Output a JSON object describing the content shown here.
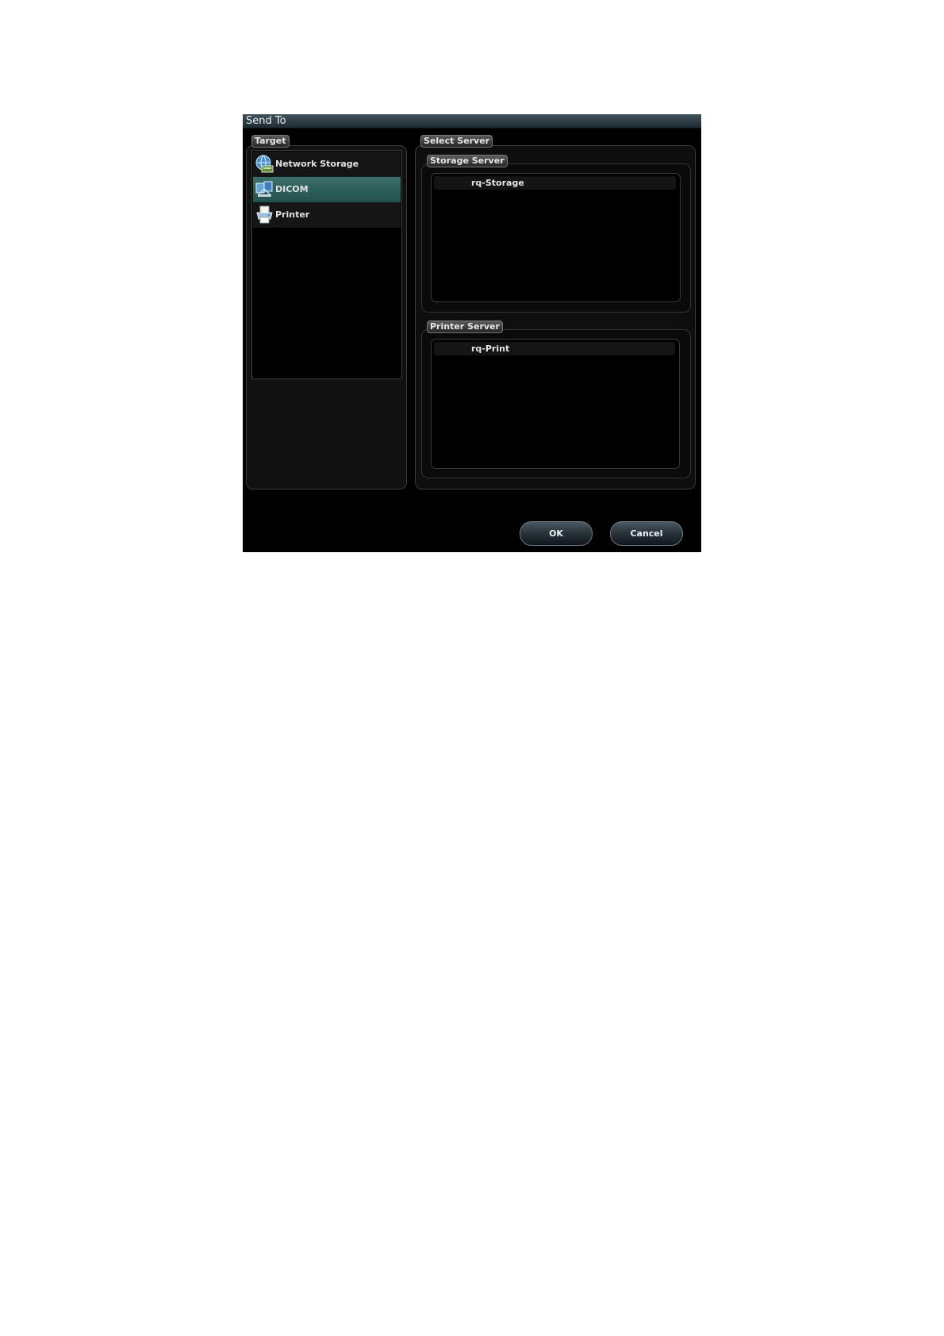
{
  "dialog": {
    "title": "Send To"
  },
  "target": {
    "label": "Target",
    "items": [
      {
        "label": "Network Storage",
        "icon": "network-storage-icon",
        "selected": false
      },
      {
        "label": "DICOM",
        "icon": "dicom-icon",
        "selected": true
      },
      {
        "label": "Printer",
        "icon": "printer-icon",
        "selected": false
      }
    ]
  },
  "select_server": {
    "label": "Select Server",
    "storage": {
      "label": "Storage Server",
      "items": [
        "rq-Storage"
      ]
    },
    "printer": {
      "label": "Printer Server",
      "items": [
        "rq-Print"
      ]
    }
  },
  "buttons": {
    "ok": "OK",
    "cancel": "Cancel"
  },
  "colors": {
    "selected_row": "#2f615d",
    "title_bar": "#2f3d45",
    "background": "#000000"
  }
}
